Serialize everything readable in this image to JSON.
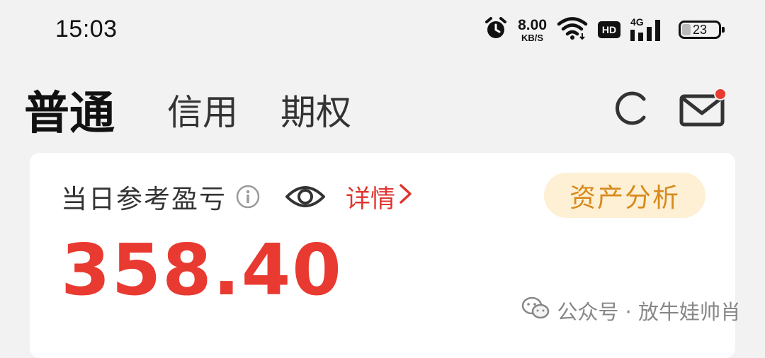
{
  "status_bar": {
    "time": "15:03",
    "net_speed_value": "8.00",
    "net_speed_unit": "KB/S",
    "hd_label": "HD",
    "signal_label": "4G",
    "battery_level": "23",
    "battery_fraction": 0.23
  },
  "tabs": [
    {
      "label": "普通",
      "active": true
    },
    {
      "label": "信用",
      "active": false
    },
    {
      "label": "期权",
      "active": false
    }
  ],
  "header_icons": {
    "refresh": "refresh-icon",
    "mail": "mail-icon",
    "mail_has_unread": true
  },
  "card": {
    "pnl_label": "当日参考盈亏",
    "detail_link": "详情",
    "asset_button": "资产分析",
    "pnl_value": "358.40"
  },
  "watermark": {
    "text": "公众号 · 放牛娃帅肖"
  },
  "colors": {
    "accent_red": "#e83a30",
    "asset_button_bg": "#fdf0d5",
    "asset_button_text": "#d88a1c",
    "page_bg": "#f2f2f2",
    "card_bg": "#ffffff"
  }
}
